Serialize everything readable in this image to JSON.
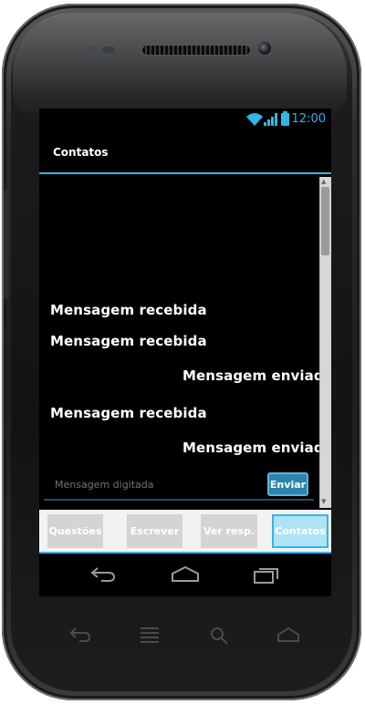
{
  "status_bar": {
    "time": "12:00",
    "icons": [
      "wifi-icon",
      "signal-icon",
      "battery-icon"
    ]
  },
  "action_bar": {
    "title": "Contatos"
  },
  "messages": [
    {
      "type": "received",
      "text": "Mensagem recebida"
    },
    {
      "type": "received",
      "text": "Mensagem recebida"
    },
    {
      "type": "sent",
      "text": "Mensagem enviada"
    },
    {
      "type": "received",
      "text": "Mensagem recebida"
    },
    {
      "type": "sent",
      "text": "Mensagem enviada"
    }
  ],
  "composer": {
    "placeholder": "Mensagem digitada",
    "send_label": "Enviar"
  },
  "tabs": [
    {
      "label": "Questões",
      "active": false
    },
    {
      "label": "Escrever",
      "active": false
    },
    {
      "label": "Ver resp.",
      "active": false
    },
    {
      "label": "Contatos",
      "active": true
    }
  ],
  "colors": {
    "accent": "#33b5e5",
    "send_button": "#2a85ad",
    "tab_inactive": "#d4d4d4",
    "tab_active": "#aee3f5"
  },
  "nav_icons": [
    "back-icon",
    "home-icon",
    "recents-icon"
  ],
  "hardware_keys": [
    "back-icon",
    "menu-icon",
    "search-icon",
    "home-icon"
  ]
}
